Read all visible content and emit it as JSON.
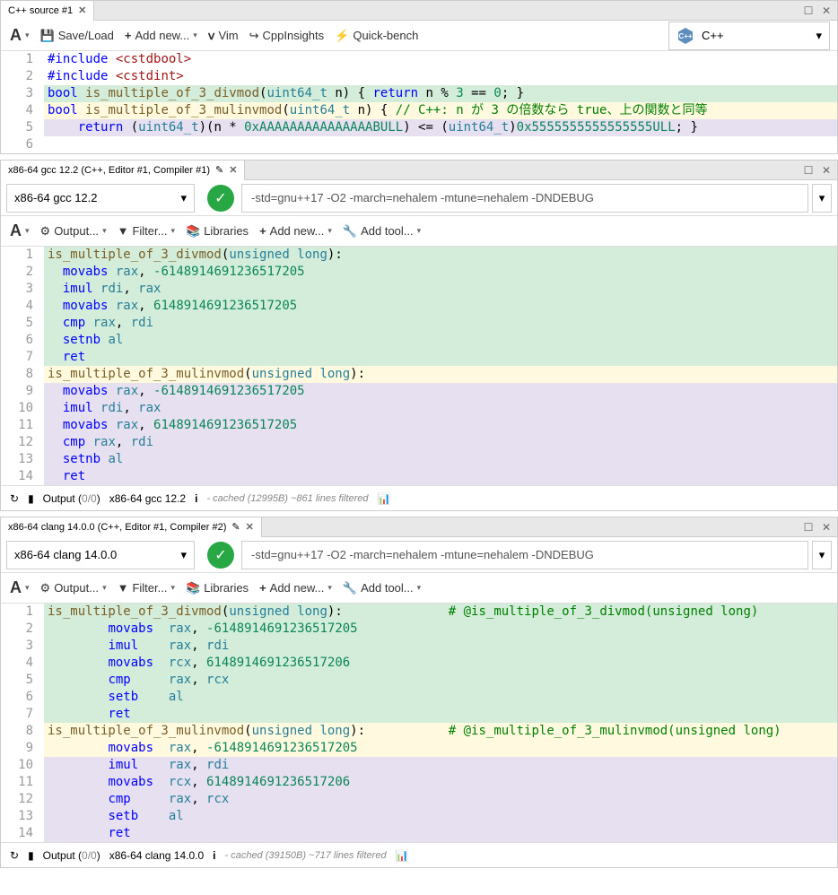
{
  "source": {
    "tab": "C++ source #1",
    "toolbar": {
      "save": "Save/Load",
      "add": "Add new...",
      "vim": "Vim",
      "cpp": "CppInsights",
      "qb": "Quick-bench"
    },
    "lang": "C++",
    "lines": [
      {
        "n": "1",
        "bg": "",
        "html": "<span class='kw'>#include</span> <span class='str'>&lt;cstdbool&gt;</span>"
      },
      {
        "n": "2",
        "bg": "",
        "html": "<span class='kw'>#include</span> <span class='str'>&lt;cstdint&gt;</span>"
      },
      {
        "n": "3",
        "bg": "hl-green",
        "html": "<span class='kw'>bool</span> <span class='fn'>is_multiple_of_3_divmod</span>(<span class='type'>uint64_t</span> n) { <span class='kw'>return</span> n % <span class='num'>3</span> == <span class='num'>0</span>; }"
      },
      {
        "n": "4",
        "bg": "hl-yellow",
        "html": "<span class='kw'>bool</span> <span class='fn'>is_multiple_of_3_mulinvmod</span>(<span class='type'>uint64_t</span> n) { <span class='comment'>// C++: n が 3 の倍数なら true、上の関数と同等</span>"
      },
      {
        "n": "5",
        "bg": "hl-purple",
        "html": "    <span class='kw'>return</span> (<span class='type'>uint64_t</span>)(n * <span class='num'>0xAAAAAAAAAAAAAAABULL</span>) &lt;= (<span class='type'>uint64_t</span>)<span class='num'>0x5555555555555555ULL</span>; }"
      },
      {
        "n": "6",
        "bg": "",
        "html": ""
      }
    ]
  },
  "gcc": {
    "tab": "x86-64 gcc 12.2 (C++, Editor #1, Compiler #1)",
    "compiler": "x86-64 gcc 12.2",
    "opts": "-std=gnu++17 -O2 -march=nehalem -mtune=nehalem -DNDEBUG",
    "toolbar": {
      "output": "Output...",
      "filter": "Filter...",
      "libs": "Libraries",
      "add": "Add new...",
      "tool": "Add tool..."
    },
    "lines": [
      {
        "n": "1",
        "bg": "hl-green",
        "html": "<span class='fn'>is_multiple_of_3_divmod</span>(<span class='type'>unsigned long</span>):"
      },
      {
        "n": "2",
        "bg": "hl-green",
        "html": "  <span class='kw'>movabs</span> <span class='type'>rax</span>, <span class='num'>-6148914691236517205</span>"
      },
      {
        "n": "3",
        "bg": "hl-green",
        "html": "  <span class='kw'>imul</span> <span class='type'>rdi</span>, <span class='type'>rax</span>"
      },
      {
        "n": "4",
        "bg": "hl-green",
        "html": "  <span class='kw'>movabs</span> <span class='type'>rax</span>, <span class='num'>6148914691236517205</span>"
      },
      {
        "n": "5",
        "bg": "hl-green",
        "html": "  <span class='kw'>cmp</span> <span class='type'>rax</span>, <span class='type'>rdi</span>"
      },
      {
        "n": "6",
        "bg": "hl-green",
        "html": "  <span class='kw'>setnb</span> <span class='type'>al</span>"
      },
      {
        "n": "7",
        "bg": "hl-green",
        "html": "  <span class='kw'>ret</span>"
      },
      {
        "n": "8",
        "bg": "hl-yellow",
        "html": "<span class='fn'>is_multiple_of_3_mulinvmod</span>(<span class='type'>unsigned long</span>):"
      },
      {
        "n": "9",
        "bg": "hl-purple",
        "html": "  <span class='kw'>movabs</span> <span class='type'>rax</span>, <span class='num'>-6148914691236517205</span>"
      },
      {
        "n": "10",
        "bg": "hl-purple",
        "html": "  <span class='kw'>imul</span> <span class='type'>rdi</span>, <span class='type'>rax</span>"
      },
      {
        "n": "11",
        "bg": "hl-purple",
        "html": "  <span class='kw'>movabs</span> <span class='type'>rax</span>, <span class='num'>6148914691236517205</span>"
      },
      {
        "n": "12",
        "bg": "hl-purple",
        "html": "  <span class='kw'>cmp</span> <span class='type'>rax</span>, <span class='type'>rdi</span>"
      },
      {
        "n": "13",
        "bg": "hl-purple",
        "html": "  <span class='kw'>setnb</span> <span class='type'>al</span>"
      },
      {
        "n": "14",
        "bg": "hl-purple",
        "html": "  <span class='kw'>ret</span>"
      }
    ],
    "status": {
      "output": "Output (0/0)",
      "comp": "x86-64 gcc 12.2",
      "cache": "- cached (12995B) ~861 lines filtered"
    }
  },
  "clang": {
    "tab": "x86-64 clang 14.0.0 (C++, Editor #1, Compiler #2)",
    "compiler": "x86-64 clang 14.0.0",
    "opts": "-std=gnu++17 -O2 -march=nehalem -mtune=nehalem -DNDEBUG",
    "toolbar": {
      "output": "Output...",
      "filter": "Filter...",
      "libs": "Libraries",
      "add": "Add new...",
      "tool": "Add tool..."
    },
    "lines": [
      {
        "n": "1",
        "bg": "hl-green",
        "html": "<span class='fn'>is_multiple_of_3_divmod</span>(<span class='type'>unsigned long</span>):              <span class='comment'># @is_multiple_of_3_divmod(unsigned long)</span>"
      },
      {
        "n": "2",
        "bg": "hl-green",
        "html": "        <span class='kw'>movabs</span>  <span class='type'>rax</span>, <span class='num'>-6148914691236517205</span>"
      },
      {
        "n": "3",
        "bg": "hl-green",
        "html": "        <span class='kw'>imul</span>    <span class='type'>rax</span>, <span class='type'>rdi</span>"
      },
      {
        "n": "4",
        "bg": "hl-green",
        "html": "        <span class='kw'>movabs</span>  <span class='type'>rcx</span>, <span class='num'>6148914691236517206</span>"
      },
      {
        "n": "5",
        "bg": "hl-green",
        "html": "        <span class='kw'>cmp</span>     <span class='type'>rax</span>, <span class='type'>rcx</span>"
      },
      {
        "n": "6",
        "bg": "hl-green",
        "html": "        <span class='kw'>setb</span>    <span class='type'>al</span>"
      },
      {
        "n": "7",
        "bg": "hl-green",
        "html": "        <span class='kw'>ret</span>"
      },
      {
        "n": "8",
        "bg": "hl-yellow",
        "html": "<span class='fn'>is_multiple_of_3_mulinvmod</span>(<span class='type'>unsigned long</span>):           <span class='comment'># @is_multiple_of_3_mulinvmod(unsigned long)</span>"
      },
      {
        "n": "9",
        "bg": "hl-yellow",
        "html": "        <span class='kw'>movabs</span>  <span class='type'>rax</span>, <span class='num'>-6148914691236517205</span>"
      },
      {
        "n": "10",
        "bg": "hl-purple",
        "html": "        <span class='kw'>imul</span>    <span class='type'>rax</span>, <span class='type'>rdi</span>"
      },
      {
        "n": "11",
        "bg": "hl-purple",
        "html": "        <span class='kw'>movabs</span>  <span class='type'>rcx</span>, <span class='num'>6148914691236517206</span>"
      },
      {
        "n": "12",
        "bg": "hl-purple",
        "html": "        <span class='kw'>cmp</span>     <span class='type'>rax</span>, <span class='type'>rcx</span>"
      },
      {
        "n": "13",
        "bg": "hl-purple",
        "html": "        <span class='kw'>setb</span>    <span class='type'>al</span>"
      },
      {
        "n": "14",
        "bg": "hl-purple",
        "html": "        <span class='kw'>ret</span>"
      }
    ],
    "status": {
      "output": "Output (0/0)",
      "comp": "x86-64 clang 14.0.0",
      "cache": "- cached (39150B) ~717 lines filtered"
    }
  }
}
